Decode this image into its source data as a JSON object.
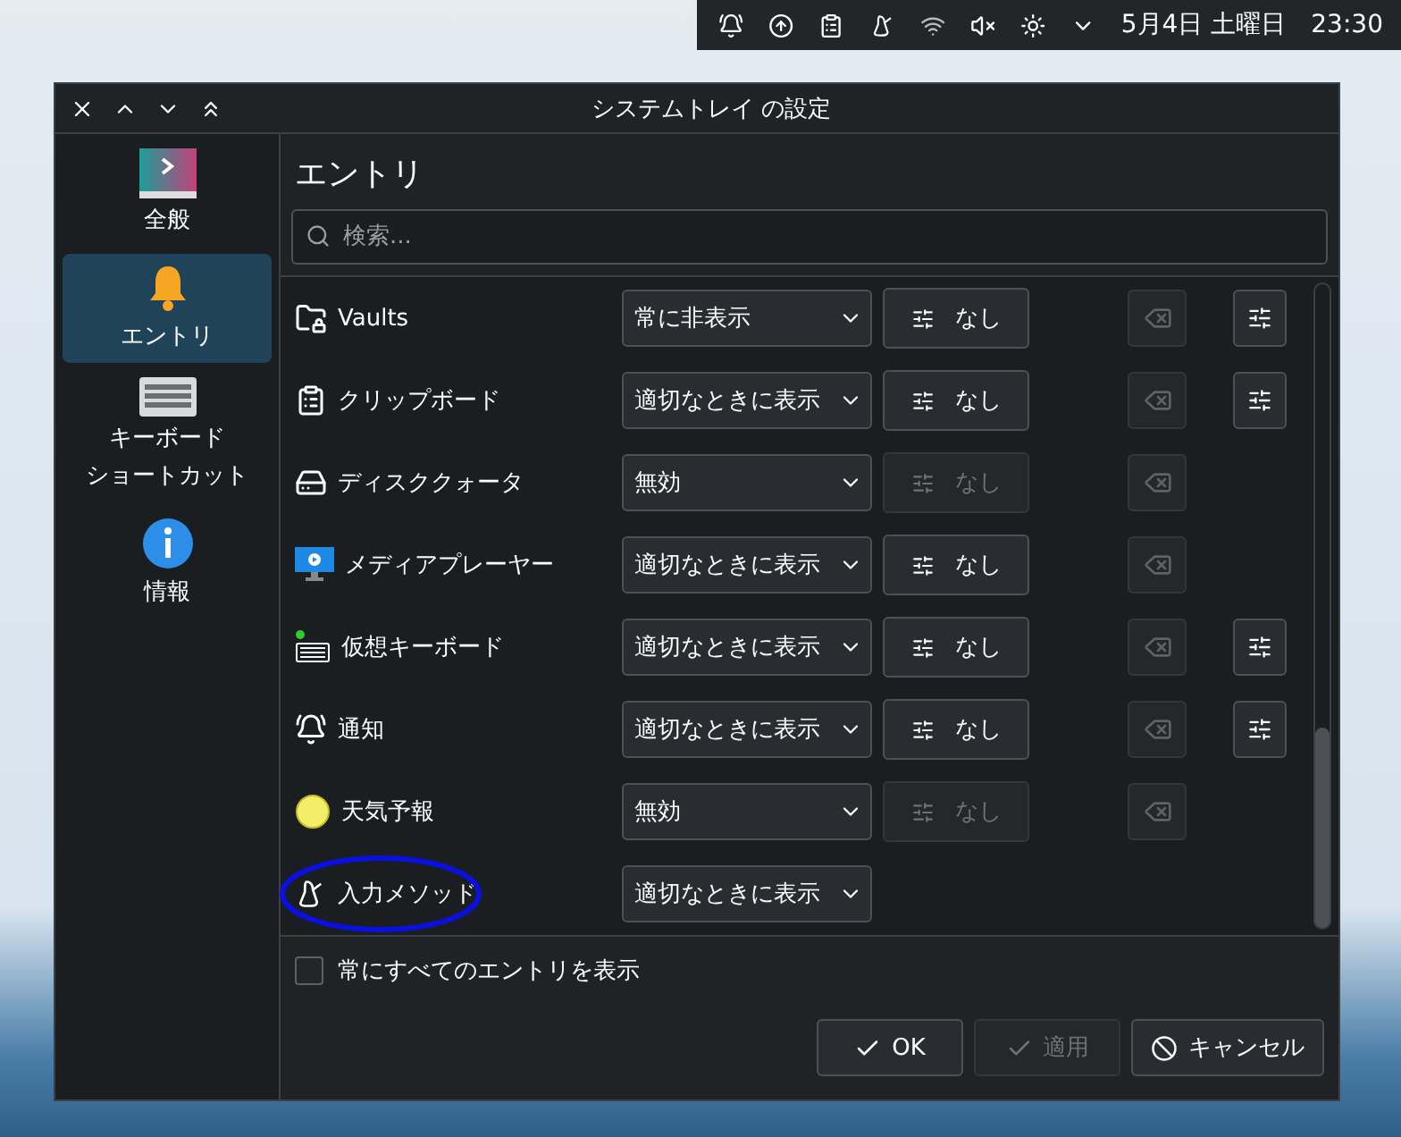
{
  "panel": {
    "date": "5月4日 土曜日",
    "time": "23:30"
  },
  "window": {
    "title": "システムトレイ の設定"
  },
  "sidebar": {
    "items": [
      {
        "lines": [
          "全般"
        ],
        "selected": false
      },
      {
        "lines": [
          "エントリ"
        ],
        "selected": true
      },
      {
        "lines": [
          "キーボード",
          "ショートカット"
        ],
        "selected": false
      },
      {
        "lines": [
          "情報"
        ],
        "selected": false
      }
    ]
  },
  "heading": "エントリ",
  "search": {
    "placeholder": "検索..."
  },
  "entries": [
    {
      "name": "Vaults",
      "visibility": "常に非表示",
      "shortcut": "なし",
      "shortcut_enabled": true,
      "configurable": true
    },
    {
      "name": "クリップボード",
      "visibility": "適切なときに表示",
      "shortcut": "なし",
      "shortcut_enabled": true,
      "configurable": true
    },
    {
      "name": "ディスククォータ",
      "visibility": "無効",
      "shortcut": "なし",
      "shortcut_enabled": false,
      "configurable": false
    },
    {
      "name": "メディアプレーヤー",
      "visibility": "適切なときに表示",
      "shortcut": "なし",
      "shortcut_enabled": true,
      "configurable": false
    },
    {
      "name": "仮想キーボード",
      "visibility": "適切なときに表示",
      "shortcut": "なし",
      "shortcut_enabled": true,
      "configurable": true
    },
    {
      "name": "通知",
      "visibility": "適切なときに表示",
      "shortcut": "なし",
      "shortcut_enabled": true,
      "configurable": true
    },
    {
      "name": "天気予報",
      "visibility": "無効",
      "shortcut": "なし",
      "shortcut_enabled": false,
      "configurable": false
    },
    {
      "name": "入力メソッド",
      "visibility": "適切なときに表示",
      "configurable": false,
      "circled": true
    }
  ],
  "show_all": {
    "label": "常にすべてのエントリを表示",
    "checked": false
  },
  "buttons": [
    {
      "kind": "ok",
      "label": "OK",
      "disabled": false
    },
    {
      "kind": "ok",
      "label": "適用",
      "disabled": true
    },
    {
      "kind": "cancel",
      "label": "キャンセル",
      "disabled": false
    }
  ]
}
